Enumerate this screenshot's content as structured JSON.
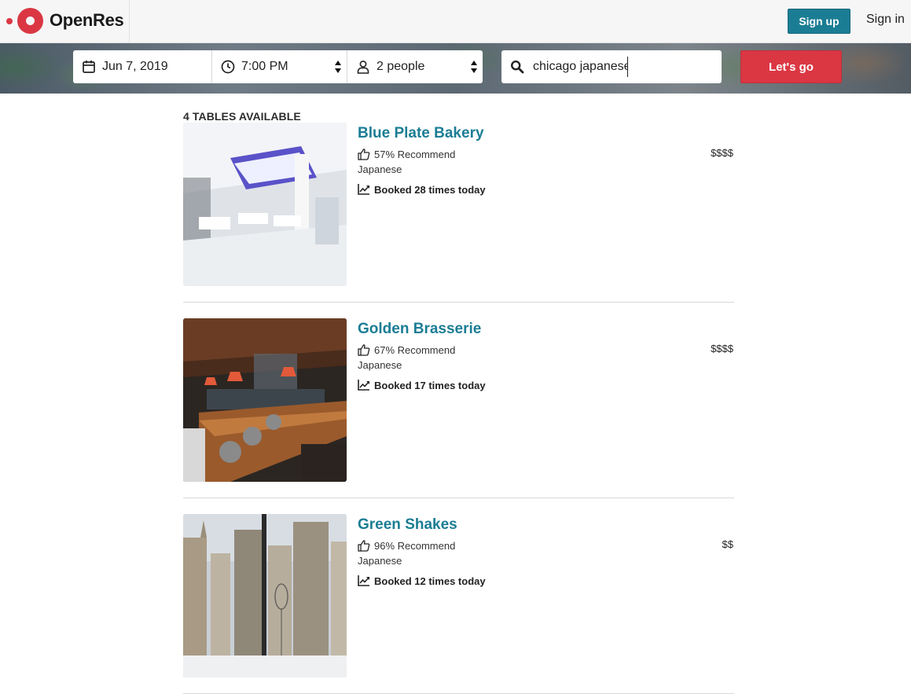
{
  "app": {
    "name": "OpenRes"
  },
  "nav": {
    "signup_label": "Sign up",
    "signin_label": "Sign in"
  },
  "search": {
    "date": "Jun 7, 2019",
    "time": "7:00 PM",
    "party": "2 people",
    "query": "chicago japanese",
    "submit_label": "Let's go"
  },
  "results": {
    "count_label": "4 TABLES AVAILABLE",
    "items": [
      {
        "name": "Blue Plate Bakery",
        "recommend": "57% Recommend",
        "cuisine": "Japanese",
        "booked": "Booked 28 times today",
        "price": "$$$$"
      },
      {
        "name": "Golden Brasserie",
        "recommend": "67% Recommend",
        "cuisine": "Japanese",
        "booked": "Booked 17 times today",
        "price": "$$$$"
      },
      {
        "name": "Green Shakes",
        "recommend": "96% Recommend",
        "cuisine": "Japanese",
        "booked": "Booked 12 times today",
        "price": "$$"
      }
    ]
  },
  "colors": {
    "brand_red": "#da3743",
    "teal": "#1b7d94"
  },
  "icons": [
    "calendar-icon",
    "clock-icon",
    "person-icon",
    "search-icon",
    "thumbs-up-icon",
    "trend-icon"
  ]
}
